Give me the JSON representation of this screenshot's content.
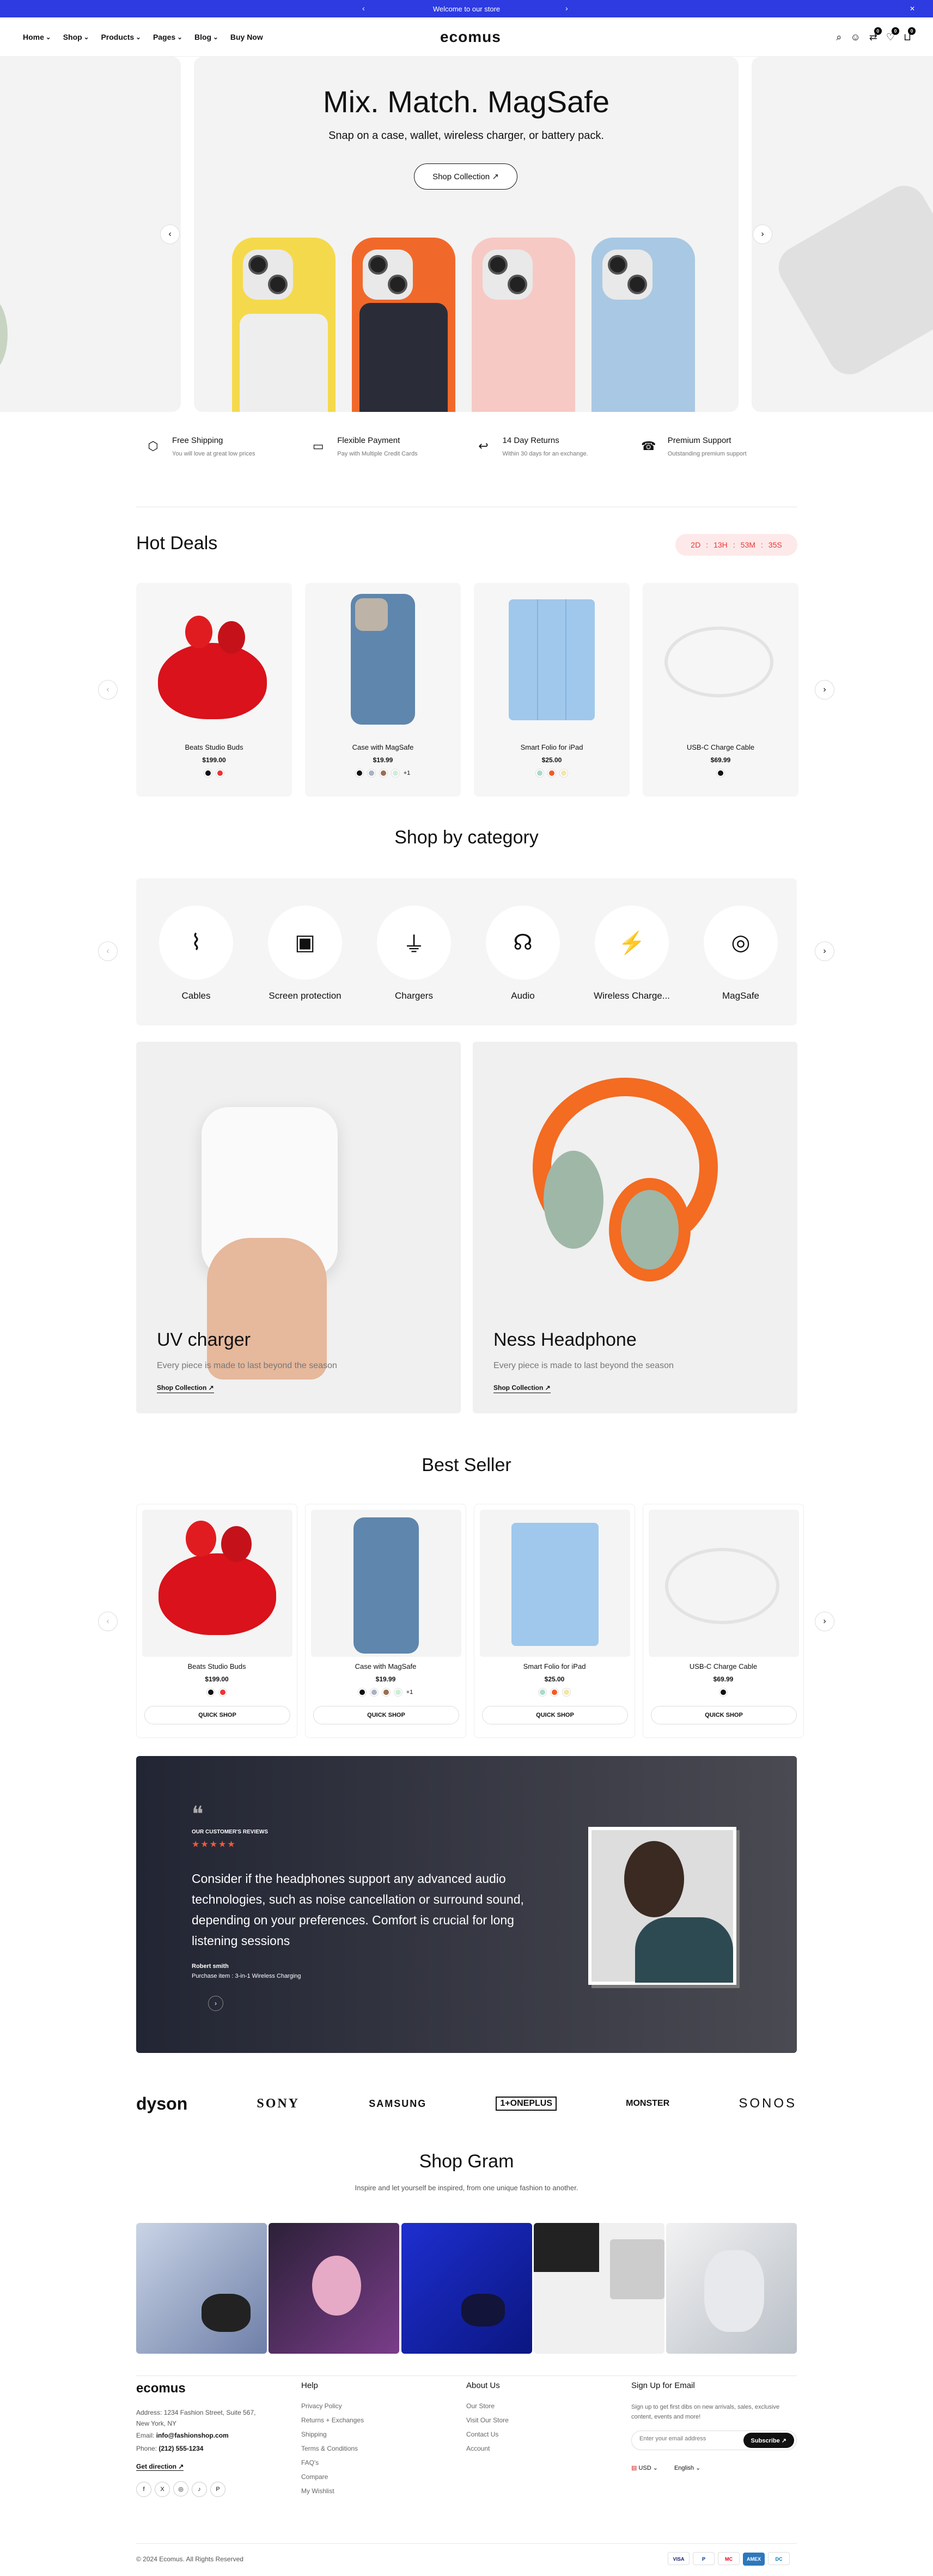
{
  "topbar": {
    "text": "Welcome to our store",
    "prev": "‹",
    "next": "›",
    "close": "✕"
  },
  "nav": {
    "logo": "ecomus",
    "menu": [
      "Home",
      "Shop",
      "Products",
      "Pages",
      "Blog",
      "Buy Now"
    ],
    "cart_count": "0",
    "wish_count": "0",
    "compare_count": "0"
  },
  "hero": {
    "title": "Mix. Match. MagSafe",
    "subtitle": "Snap on a case, wallet, wireless charger, or battery pack.",
    "button": "Shop Collection"
  },
  "features": [
    {
      "title": "Free Shipping",
      "desc": "You will love at great low prices",
      "icon": "box-icon"
    },
    {
      "title": "Flexible Payment",
      "desc": "Pay with Multiple Credit Cards",
      "icon": "card-icon"
    },
    {
      "title": "14 Day Returns",
      "desc": "Within 30 days for an exchange.",
      "icon": "return-icon"
    },
    {
      "title": "Premium Support",
      "desc": "Outstanding premium support",
      "icon": "support-icon"
    }
  ],
  "hot": {
    "title": "Hot Deals",
    "timer": [
      "2D",
      ":",
      "13H",
      ":",
      "53M",
      ":",
      "35S"
    ]
  },
  "products": [
    {
      "name": "Beats Studio Buds",
      "price": "$199.00",
      "swatches": [
        "#111",
        "#e33"
      ],
      "more": ""
    },
    {
      "name": "Case with MagSafe",
      "price": "$19.99",
      "swatches": [
        "#111",
        "#a7b2c2",
        "#9a6e52",
        "#cdeed8"
      ],
      "more": "+1"
    },
    {
      "name": "Smart Folio for iPad",
      "price": "$25.00",
      "swatches": [
        "#a9dbc7",
        "#f25a24",
        "#f2e8a5"
      ],
      "more": ""
    },
    {
      "name": "USB-C Charge Cable",
      "price": "$69.99",
      "swatches": [
        "#111"
      ],
      "more": ""
    }
  ],
  "category": {
    "title": "Shop by category",
    "items": [
      {
        "label": "Cables",
        "icon": "cable-icon",
        "glyph": "⌇"
      },
      {
        "label": "Screen protection",
        "icon": "phone-icon",
        "glyph": "▣"
      },
      {
        "label": "Chargers",
        "icon": "charger-icon",
        "glyph": "⏚"
      },
      {
        "label": "Audio",
        "icon": "headphone-icon",
        "glyph": "🎧"
      },
      {
        "label": "Wireless Charge...",
        "icon": "wireless-icon",
        "glyph": "⚡"
      },
      {
        "label": "MagSafe",
        "icon": "magsafe-icon",
        "glyph": "◎"
      }
    ]
  },
  "promos": [
    {
      "title": "UV charger",
      "desc": "Every piece is made to last beyond the season",
      "link": "Shop Collection ↗"
    },
    {
      "title": "Ness Headphone",
      "desc": "Every piece is made to last beyond the season",
      "link": "Shop Collection ↗"
    }
  ],
  "bestseller": {
    "title": "Best Seller",
    "quick": "QUICK SHOP"
  },
  "review": {
    "label": "OUR CUSTOMER'S REVIEWS",
    "stars": "★★★★★",
    "text": "Consider if the headphones support any advanced audio technologies, such as noise cancellation or surround sound, depending on your preferences. Comfort is crucial for long listening sessions",
    "author": "Robert smith",
    "purchase": "Purchase item : 3-in-1 Wireless Charging"
  },
  "brands": [
    "dyson",
    "SONY",
    "SAMSUNG",
    "1+ONEPLUS",
    "MONSTER",
    "SONOS"
  ],
  "gram": {
    "title": "Shop Gram",
    "subtitle": "Inspire and let yourself be inspired, from one unique fashion to another."
  },
  "footer": {
    "logo": "ecomus",
    "address": "Address: 1234 Fashion Street, Suite 567,",
    "city": "New York, NY",
    "email_label": "Email: ",
    "email": "info@fashionshop.com",
    "phone_label": "Phone: ",
    "phone": "(212) 555-1234",
    "direction": "Get direction ↗",
    "social": [
      "f",
      "X",
      "◎",
      "♪",
      "P"
    ],
    "help": {
      "title": "Help",
      "links": [
        "Privacy Policy",
        "Returns + Exchanges",
        "Shipping",
        "Terms & Conditions",
        "FAQ's",
        "Compare",
        "My Wishlist"
      ]
    },
    "about": {
      "title": "About Us",
      "links": [
        "Our Store",
        "Visit Our Store",
        "Contact Us",
        "Account"
      ]
    },
    "signup": {
      "title": "Sign Up for Email",
      "desc": "Sign up to get first dibs on new arrivals, sales, exclusive content, events and more!",
      "placeholder": "Enter your email address",
      "button": "Subscribe ↗"
    },
    "currency": "USD ⌄",
    "language": "English ⌄",
    "copyright": "© 2024 Ecomus. All Rights Reserved",
    "payments": [
      "VISA",
      "P",
      "MC",
      "AMEX",
      "DC"
    ]
  }
}
